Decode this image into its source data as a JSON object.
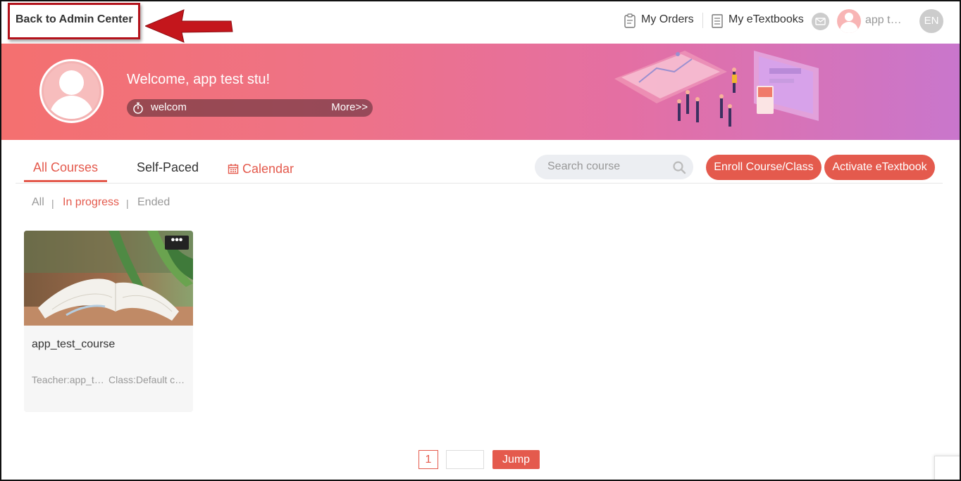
{
  "header": {
    "back_label": "Back to Admin Center",
    "orders_label": "My Orders",
    "etextbooks_label": "My eTextbooks",
    "user_name": "app  test stu",
    "lang_label": "EN"
  },
  "banner": {
    "welcome": "Welcome, app  test  stu!",
    "notice_text": "welcom",
    "more_label": "More>>"
  },
  "tabs": {
    "all_courses": "All Courses",
    "self_paced": "Self-Paced",
    "calendar": "Calendar"
  },
  "search": {
    "placeholder": "Search course"
  },
  "actions": {
    "enroll": "Enroll Course/Class",
    "activate": "Activate eTextbook"
  },
  "filters": {
    "all": "All",
    "in_progress": "In progress",
    "ended": "Ended",
    "separator": "|"
  },
  "courses": [
    {
      "title": "app_test_course",
      "teacher": "Teacher:app_test stu",
      "class": "Class:Default class",
      "menu": "•••"
    }
  ],
  "pagination": {
    "current_page": "1",
    "jump_label": "Jump"
  },
  "colors": {
    "accent": "#e45a4d",
    "annotation_red": "#b3121b"
  }
}
